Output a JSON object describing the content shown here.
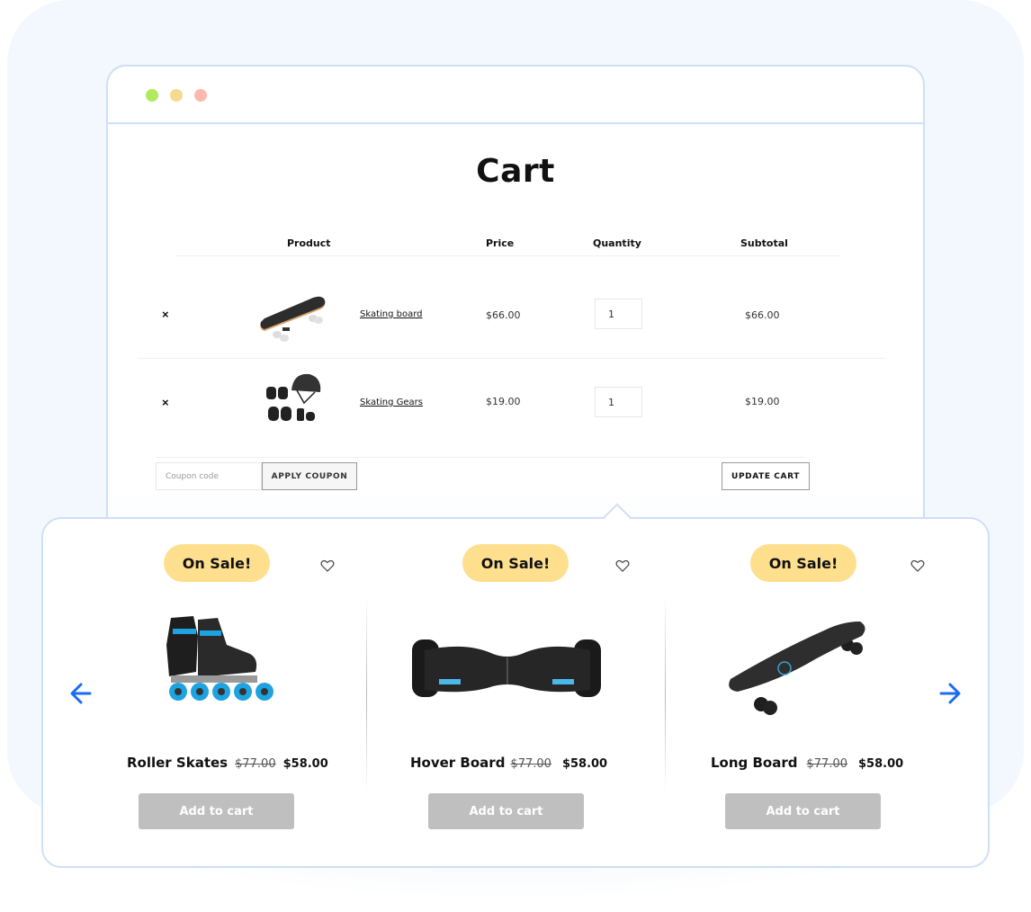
{
  "window": {
    "controls": [
      "green",
      "yellow",
      "red"
    ]
  },
  "cart": {
    "title": "Cart",
    "headers": {
      "product": "Product",
      "price": "Price",
      "quantity": "Quantity",
      "subtotal": "Subtotal"
    },
    "items": [
      {
        "remove_icon": "×",
        "image": "skateboard-image",
        "name": "Skating board",
        "price": "$66.00",
        "quantity": "1",
        "subtotal": "$66.00"
      },
      {
        "remove_icon": "×",
        "image": "skating-gear-image",
        "name": "Skating Gears",
        "price": "$19.00",
        "quantity": "1",
        "subtotal": "$19.00"
      }
    ],
    "coupon_placeholder": "Coupon code",
    "apply_coupon_label": "APPLY COUPON",
    "update_cart_label": "UPDATE CART"
  },
  "carousel": {
    "prev_icon": "arrow-left-icon",
    "next_icon": "arrow-right-icon",
    "accent_color": "#1a6cf0",
    "badge_color": "#fedf8e",
    "products": [
      {
        "badge": "On Sale!",
        "name": "Roller Skates",
        "old_price": "$77.00",
        "price": "$58.00",
        "button": "Add to cart",
        "image": "roller-skates-image"
      },
      {
        "badge": "On Sale!",
        "name": "Hover Board",
        "old_price": "$77.00",
        "price": "$58.00",
        "button": "Add to cart",
        "image": "hover-board-image"
      },
      {
        "badge": "On Sale!",
        "name": "Long Board",
        "old_price": "$77.00",
        "price": "$58.00",
        "button": "Add to cart",
        "image": "long-board-image"
      }
    ]
  }
}
